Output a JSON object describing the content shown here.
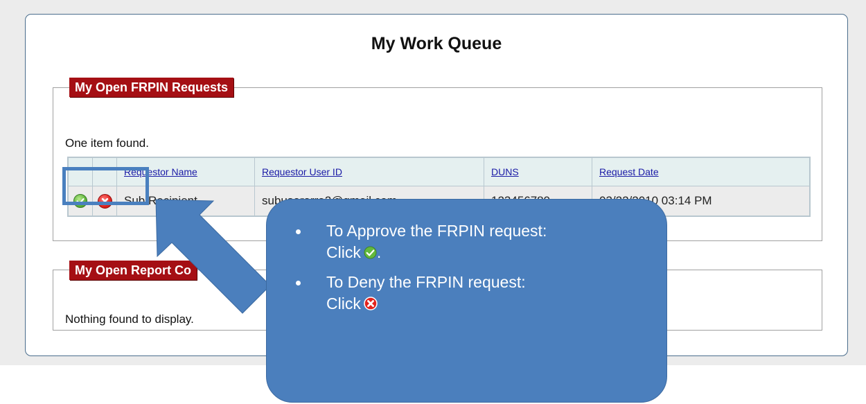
{
  "page": {
    "title": "My Work Queue"
  },
  "requests_section": {
    "legend": "My Open FRPIN Requests",
    "found_text": "One item found.",
    "columns": [
      "Requestor Name",
      "Requestor User ID",
      "DUNS",
      "Request Date"
    ],
    "rows": [
      {
        "requestor_name": "Sub Recipient",
        "requestor_user_id": "subuserarra2@gmail.com",
        "duns": "123456789",
        "request_date": "03/22/2010 03:14 PM"
      }
    ]
  },
  "reports_section": {
    "legend": "My Open Report Co",
    "found_text": "Nothing found to display."
  },
  "callout": {
    "approve_line1": "To Approve the FRPIN request:",
    "approve_line2": "Click",
    "approve_period": ".",
    "deny_line1": "To Deny the FRPIN request:",
    "deny_line2": "Click"
  },
  "icons": {
    "approve": "approve-check-icon",
    "deny": "deny-x-icon"
  },
  "colors": {
    "legend_bg": "#a50f14",
    "callout_bg": "#4b7fbd",
    "table_header_bg": "#e5f0f0",
    "link": "#1a1aa6"
  }
}
